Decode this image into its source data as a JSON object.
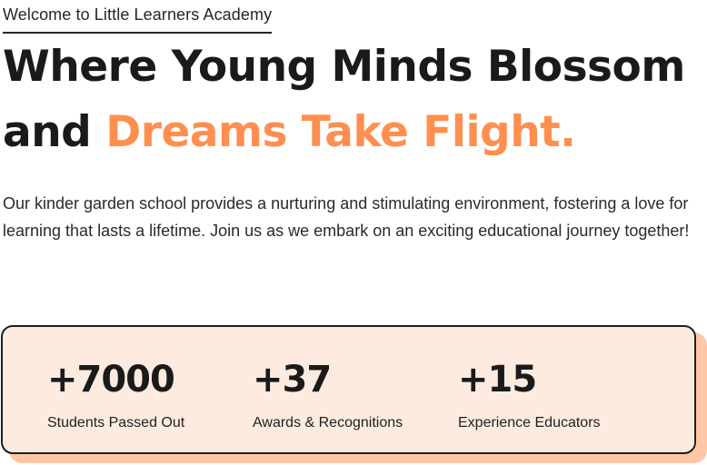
{
  "hero": {
    "eyebrow": "Welcome to Little Learners Academy",
    "headline_line1": "Where Young Minds Blossom",
    "headline_line2_prefix": "and ",
    "headline_line2_accent": "Dreams Take Flight.",
    "description": "Our kinder garden school provides a nurturing and stimulating environment, fostering a love for learning that lasts a lifetime. Join us as we embark on an exciting educational journey together!",
    "accent_color": "#ff8f4f"
  },
  "stats": {
    "card_background": "#fdebe0",
    "shadow_color": "#ffc7a6",
    "items": [
      {
        "value": "+7000",
        "label": "Students Passed Out"
      },
      {
        "value": "+37",
        "label": "Awards & Recognitions"
      },
      {
        "value": "+15",
        "label": "Experience Educators"
      }
    ]
  }
}
